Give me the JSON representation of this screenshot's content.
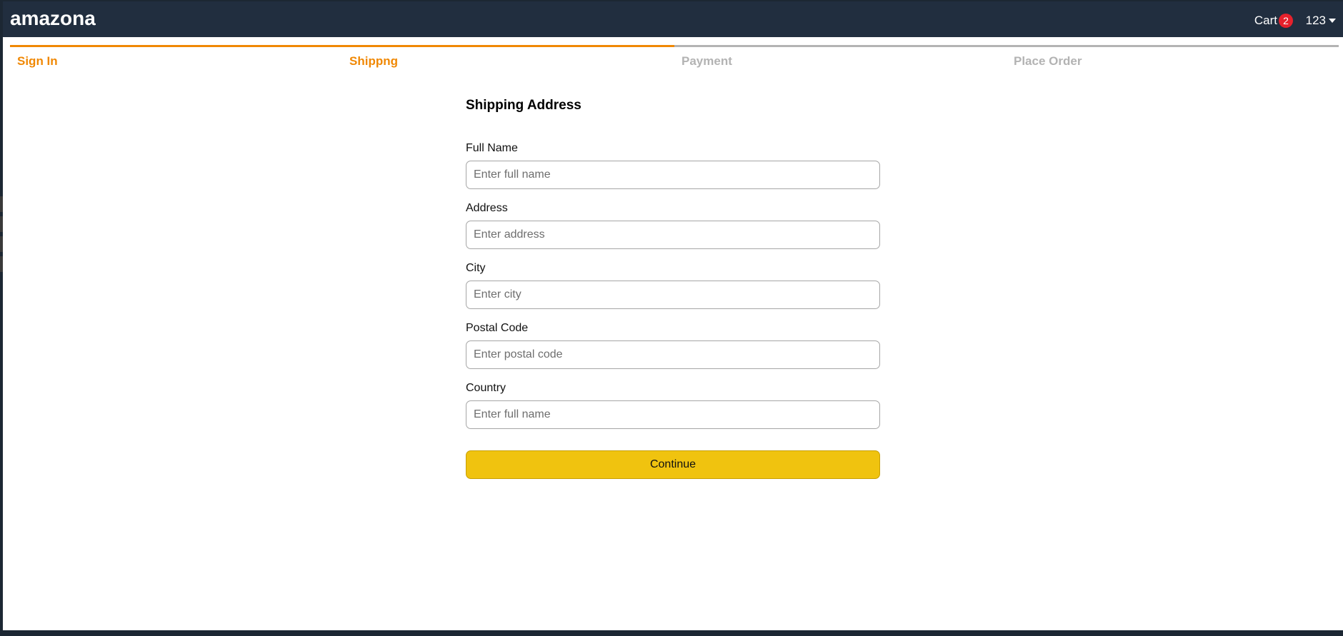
{
  "navbar": {
    "brand": "amazona",
    "cart_label": "Cart",
    "cart_count": "2",
    "user_name": "123"
  },
  "steps": [
    {
      "label": "Sign In",
      "active": true
    },
    {
      "label": "Shippng",
      "active": true
    },
    {
      "label": "Payment",
      "active": false
    },
    {
      "label": "Place Order",
      "active": false
    }
  ],
  "form": {
    "title": "Shipping Address",
    "fields": [
      {
        "label": "Full Name",
        "placeholder": "Enter full name",
        "value": ""
      },
      {
        "label": "Address",
        "placeholder": "Enter address",
        "value": ""
      },
      {
        "label": "City",
        "placeholder": "Enter city",
        "value": ""
      },
      {
        "label": "Postal Code",
        "placeholder": "Enter postal code",
        "value": ""
      },
      {
        "label": "Country",
        "placeholder": "Enter full name",
        "value": ""
      }
    ],
    "submit_label": "Continue"
  },
  "colors": {
    "navbar_bg": "#212e3f",
    "accent": "#f08804",
    "inactive_step": "#b3b3b3",
    "button_bg": "#f0c30f",
    "badge_bg": "#e6212c"
  }
}
